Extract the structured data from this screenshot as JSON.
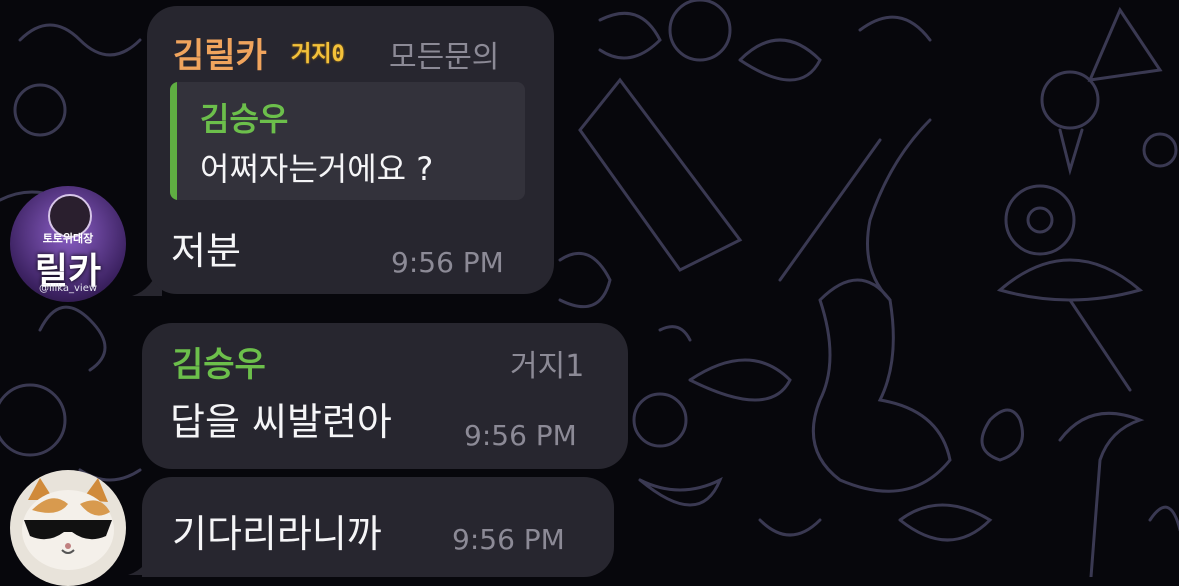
{
  "messages": [
    {
      "sender": "김릴카",
      "badge": "거지0",
      "role": "모든문의",
      "reply": {
        "sender": "김승우",
        "text": "어쩌자는거에요 ?"
      },
      "text": "저분",
      "time": "9:56 PM",
      "avatar": {
        "caption": "토토위대장",
        "title": "릴카",
        "handle": "@lilka_view"
      }
    },
    {
      "sender": "김승우",
      "role": "거지1",
      "text": "답을 씨발련아",
      "time": "9:56 PM"
    },
    {
      "text": "기다리라니까",
      "time": "9:56 PM",
      "avatar": {
        "icon": "cat-with-sunglasses"
      }
    }
  ],
  "colors": {
    "background": "#07070c",
    "bubble": "#27262f",
    "sender_orange": "#f0a45d",
    "sender_green": "#6cbf4b",
    "meta_gray": "#8c8a96"
  }
}
